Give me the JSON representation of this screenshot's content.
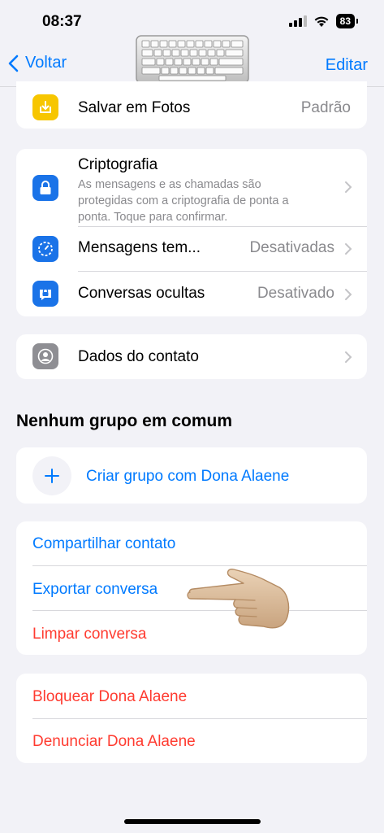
{
  "status_bar": {
    "time": "08:37",
    "battery": "83"
  },
  "nav": {
    "back_label": "Voltar",
    "edit_label": "Editar"
  },
  "rows": {
    "save_photos": {
      "title": "Salvar em Fotos",
      "value": "Padrão"
    },
    "encryption": {
      "title": "Criptografia",
      "line1": "As mensagens e as chamadas são",
      "line2": "protegidas com a criptografia de ponta a",
      "line3": "ponta. Toque para confirmar."
    },
    "temp_messages": {
      "title": "Mensagens tem...",
      "value": "Desativadas"
    },
    "hidden_chats": {
      "title": "Conversas ocultas",
      "value": "Desativado"
    },
    "contact_info": {
      "title": "Dados do contato"
    }
  },
  "groups": {
    "section_title": "Nenhum grupo em comum",
    "create_label": "Criar grupo com Dona Alaene"
  },
  "actions": {
    "share_contact": "Compartilhar contato",
    "export_chat": "Exportar conversa",
    "clear_chat": "Limpar conversa",
    "block": "Bloquear Dona Alaene",
    "report": "Denunciar Dona Alaene"
  },
  "colors": {
    "accent": "#007aff",
    "destructive": "#ff3b30",
    "background": "#f2f2f7",
    "icon_yellow": "#f7c600",
    "icon_blue": "#1a73e8",
    "icon_gray": "#8e8e93"
  },
  "icons": {
    "save_photos": "download-tray-icon",
    "encryption": "lock-icon",
    "temp_messages": "timer-icon",
    "hidden_chats": "locked-chat-icon",
    "contact_info": "person-icon",
    "create_group": "plus-icon",
    "overlay_keyboard": "keyboard-icon",
    "overlay_hand": "pointing-hand-icon"
  }
}
